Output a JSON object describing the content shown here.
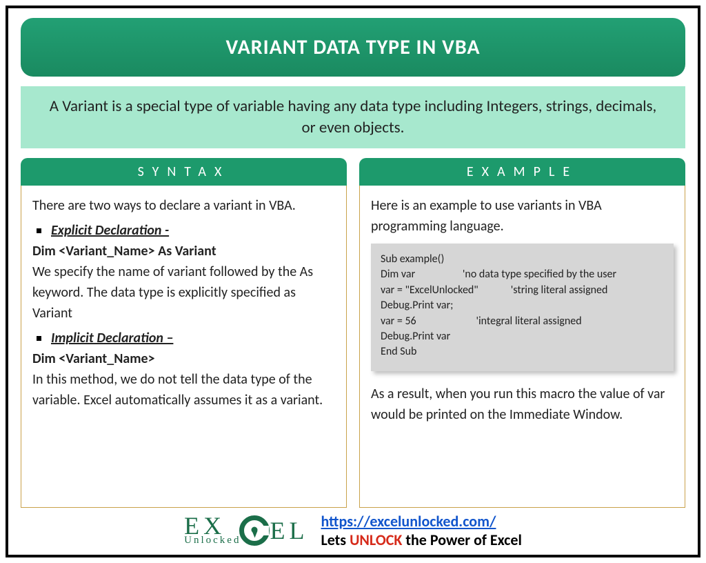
{
  "title": "VARIANT DATA TYPE IN VBA",
  "intro": "A Variant is a special type of variable having any data type including Integers, strings, decimals, or even objects.",
  "syntax": {
    "header": "SYNTAX",
    "lead": "There are two ways to declare a variant in VBA.",
    "explicit_title": "Explicit Declaration -",
    "explicit_code": "Dim <Variant_Name> As Variant",
    "explicit_desc": "We specify the name of variant followed by the As keyword. The data type is explicitly specified as Variant",
    "implicit_title": "Implicit Declaration –",
    "implicit_code": "Dim <Variant_Name>",
    "implicit_desc": "In this method, we do not tell the data type of the variable. Excel automatically assumes it as a variant."
  },
  "example": {
    "header": "EXAMPLE",
    "lead": "Here is an example to use variants in VBA programming language.",
    "code": "Sub example()\nDim var                   'no data type specified by the user\nvar = \"ExcelUnlocked\"             'string literal assigned\nDebug.Print var;\nvar = 56                        'integral literal assigned\nDebug.Print var\nEnd Sub",
    "result": "As a result, when you run this macro the value of var would be printed on the Immediate Window."
  },
  "footer": {
    "logo_left": "EX",
    "logo_sub": "Unlocked",
    "logo_right": "EL",
    "url": "https://excelunlocked.com/",
    "tagline_pre": "Lets ",
    "tagline_em": "UNLOCK",
    "tagline_post": " the Power of Excel"
  }
}
